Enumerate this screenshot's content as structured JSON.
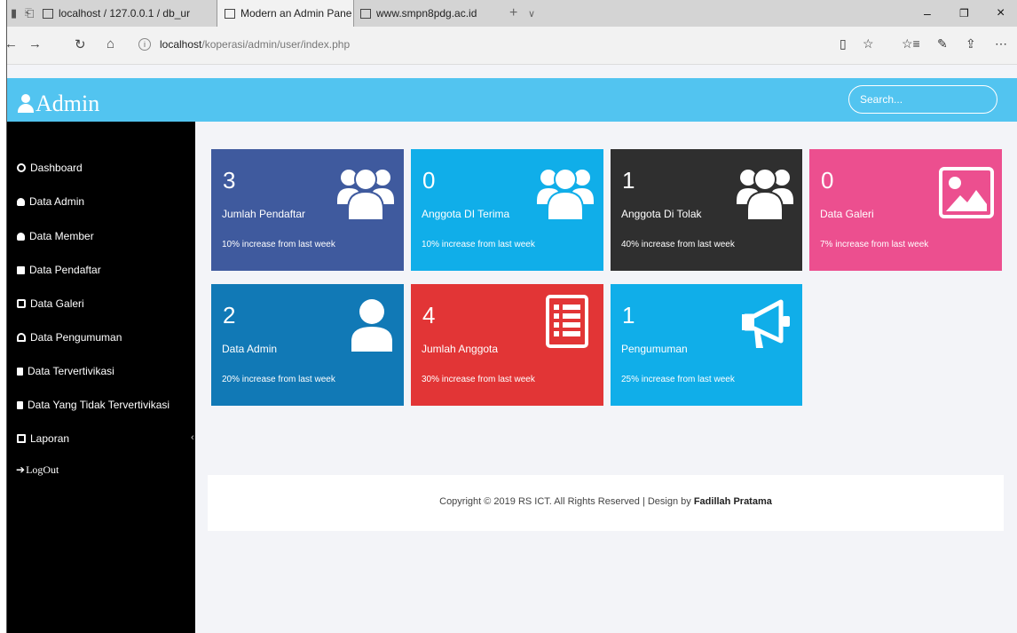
{
  "browser": {
    "tabs": [
      {
        "label": "localhost / 127.0.0.1 / db_ur"
      },
      {
        "label": "Modern an Admin Pane",
        "close": "×"
      },
      {
        "label": "www.smpn8pdg.ac.id"
      }
    ],
    "new_tab": "+",
    "tab_menu": "∨",
    "window_controls": {
      "minimize": "–",
      "maximize": "❐",
      "close": "×"
    },
    "address": {
      "host": "localhost",
      "path": "/koperasi/admin/user/index.php"
    },
    "nav": {
      "back": "←",
      "forward": "→",
      "refresh": "↻",
      "home": "⌂"
    },
    "tools": {
      "reading": "▯",
      "favorite": "☆",
      "favorites_bar": "☆≡",
      "notes": "✎",
      "share": "⇪",
      "more": "⋯"
    }
  },
  "header": {
    "brand": "Admin",
    "search_placeholder": "Search..."
  },
  "sidebar": {
    "items": [
      {
        "label": "Dashboard",
        "icon": "dashboard-icon"
      },
      {
        "label": "Data Admin",
        "icon": "user-icon"
      },
      {
        "label": "Data Member",
        "icon": "users-icon"
      },
      {
        "label": "Data Pendaftar",
        "icon": "briefcase-icon"
      },
      {
        "label": "Data Galeri",
        "icon": "gallery-icon"
      },
      {
        "label": "Data Pengumuman",
        "icon": "bell-icon"
      },
      {
        "label": "Data Tervertivikasi",
        "icon": "document-icon"
      },
      {
        "label": "Data Yang Tidak Tervertivikasi",
        "icon": "document-icon"
      },
      {
        "label": "Laporan",
        "icon": "file-icon",
        "chevron": "‹"
      },
      {
        "label": "LogOut",
        "icon": "logout-icon"
      }
    ]
  },
  "cards": [
    {
      "number": "3",
      "label": "Jumlah Pendaftar",
      "desc": "10% increase from last week",
      "color": "#3f5a9e",
      "icon": "users-icon"
    },
    {
      "number": "0",
      "label": "Anggota DI Terima",
      "desc": "10% increase from last week",
      "color": "#10aee9",
      "icon": "users-icon"
    },
    {
      "number": "1",
      "label": "Anggota Di Tolak",
      "desc": "40% increase from last week",
      "color": "#2f2f2f",
      "icon": "users-icon"
    },
    {
      "number": "0",
      "label": "Data Galeri",
      "desc": "7% increase from last week",
      "color": "#ec4f8f",
      "icon": "image-icon"
    },
    {
      "number": "2",
      "label": "Data Admin",
      "desc": "20% increase from last week",
      "color": "#1179b6",
      "icon": "user-icon"
    },
    {
      "number": "4",
      "label": "Jumlah Anggota",
      "desc": "30% increase from last week",
      "color": "#e23536",
      "icon": "list-icon"
    },
    {
      "number": "1",
      "label": "Pengumuman",
      "desc": "25% increase from last week",
      "color": "#10aee9",
      "icon": "megaphone-icon"
    }
  ],
  "footer": {
    "text": "Copyright © 2019 RS ICT. All Rights Reserved | Design by ",
    "author": "Fadillah Pratama"
  }
}
